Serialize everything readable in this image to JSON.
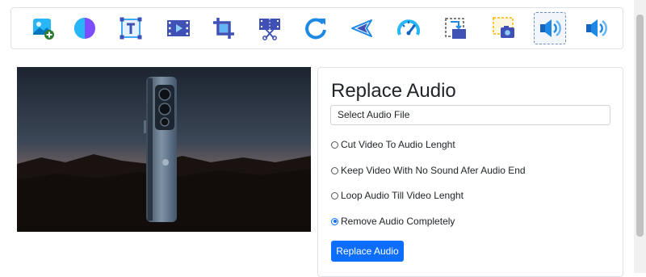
{
  "toolbar": {
    "tools": [
      {
        "icon": "add-image-icon"
      },
      {
        "icon": "color-filter-icon"
      },
      {
        "icon": "text-icon"
      },
      {
        "icon": "video-clip-icon"
      },
      {
        "icon": "crop-icon"
      },
      {
        "icon": "cut-video-icon"
      },
      {
        "icon": "rotate-icon"
      },
      {
        "icon": "rewind-icon"
      },
      {
        "icon": "speedometer-icon"
      },
      {
        "icon": "resize-icon"
      },
      {
        "icon": "screenshot-icon"
      },
      {
        "icon": "speaker-icon",
        "active": true
      },
      {
        "icon": "speaker-icon"
      }
    ]
  },
  "panel": {
    "title": "Replace Audio",
    "file_placeholder": "Select Audio File",
    "options": [
      {
        "label": "Cut Video To Audio Lenght",
        "checked": false
      },
      {
        "label": "Keep Video With No Sound Afer Audio End",
        "checked": false
      },
      {
        "label": "Loop Audio Till Video Lenght",
        "checked": false
      },
      {
        "label": "Remove Audio Completely",
        "checked": true
      }
    ],
    "button_label": "Replace Audio"
  },
  "colors": {
    "accent": "#0d6efd",
    "icon_blue": "#1e88e5",
    "icon_indigo": "#3f51b5"
  }
}
